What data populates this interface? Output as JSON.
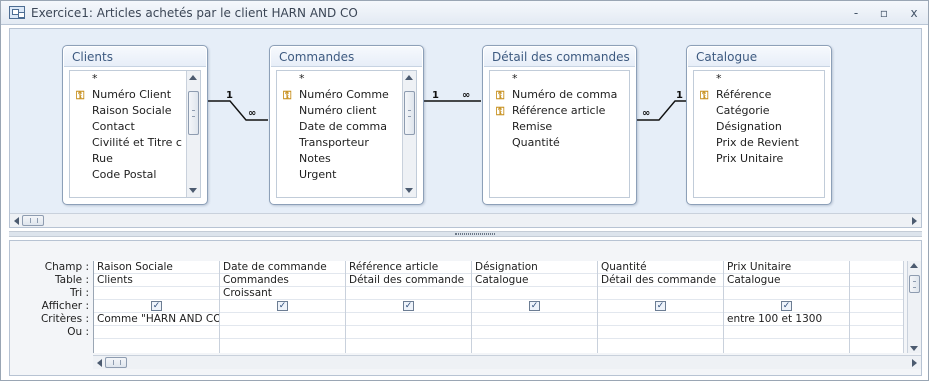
{
  "window": {
    "title": "Exercice1: Articles achetés par le client HARN AND CO",
    "minimize": "-",
    "maximize": "▫",
    "close": "x"
  },
  "tables": [
    {
      "name": "Clients",
      "fields": [
        {
          "label": "*",
          "key": false
        },
        {
          "label": "Numéro Client",
          "key": true
        },
        {
          "label": "Raison Sociale",
          "key": false
        },
        {
          "label": "Contact",
          "key": false
        },
        {
          "label": "Civilité et Titre c",
          "key": false
        },
        {
          "label": "Rue",
          "key": false
        },
        {
          "label": "Code Postal",
          "key": false
        }
      ]
    },
    {
      "name": "Commandes",
      "fields": [
        {
          "label": "*",
          "key": false
        },
        {
          "label": "Numéro Comme",
          "key": true
        },
        {
          "label": "Numéro client",
          "key": false
        },
        {
          "label": "Date de comma",
          "key": false
        },
        {
          "label": "Transporteur",
          "key": false
        },
        {
          "label": "Notes",
          "key": false
        },
        {
          "label": "Urgent",
          "key": false
        }
      ]
    },
    {
      "name": "Détail des commandes",
      "fields": [
        {
          "label": "*",
          "key": false
        },
        {
          "label": "Numéro de comma",
          "key": true
        },
        {
          "label": "Référence article",
          "key": true
        },
        {
          "label": "Remise",
          "key": false
        },
        {
          "label": "Quantité",
          "key": false
        }
      ]
    },
    {
      "name": "Catalogue",
      "fields": [
        {
          "label": "*",
          "key": false
        },
        {
          "label": "Référence",
          "key": true
        },
        {
          "label": "Catégorie",
          "key": false
        },
        {
          "label": "Désignation",
          "key": false
        },
        {
          "label": "Prix de Revient",
          "key": false
        },
        {
          "label": "Prix Unitaire",
          "key": false
        }
      ]
    }
  ],
  "relationships": [
    {
      "one": "1",
      "many": "∞"
    },
    {
      "one": "1",
      "many": "∞"
    },
    {
      "one": "1",
      "many": "∞"
    }
  ],
  "grid": {
    "row_labels": [
      "Champ :",
      "Table :",
      "Tri :",
      "Afficher :",
      "Critères :",
      "Ou :"
    ],
    "columns": [
      {
        "champ": "Raison Sociale",
        "table": "Clients",
        "tri": "",
        "afficher": true,
        "criteres": "Comme \"HARN AND CO\"",
        "ou": ""
      },
      {
        "champ": "Date de commande",
        "table": "Commandes",
        "tri": "Croissant",
        "afficher": true,
        "criteres": "",
        "ou": ""
      },
      {
        "champ": "Référence article",
        "table": "Détail des commande",
        "tri": "",
        "afficher": true,
        "criteres": "",
        "ou": ""
      },
      {
        "champ": "Désignation",
        "table": "Catalogue",
        "tri": "",
        "afficher": true,
        "criteres": "",
        "ou": ""
      },
      {
        "champ": "Quantité",
        "table": "Détail des commande",
        "tri": "",
        "afficher": true,
        "criteres": "",
        "ou": ""
      },
      {
        "champ": "Prix Unitaire",
        "table": "Catalogue",
        "tri": "",
        "afficher": true,
        "criteres": "entre 100 et 1300",
        "ou": ""
      }
    ]
  },
  "icons": {
    "key": "primary-key-icon",
    "checkbox": "checkmark-icon",
    "scroll": "scroll-arrow-icon"
  }
}
